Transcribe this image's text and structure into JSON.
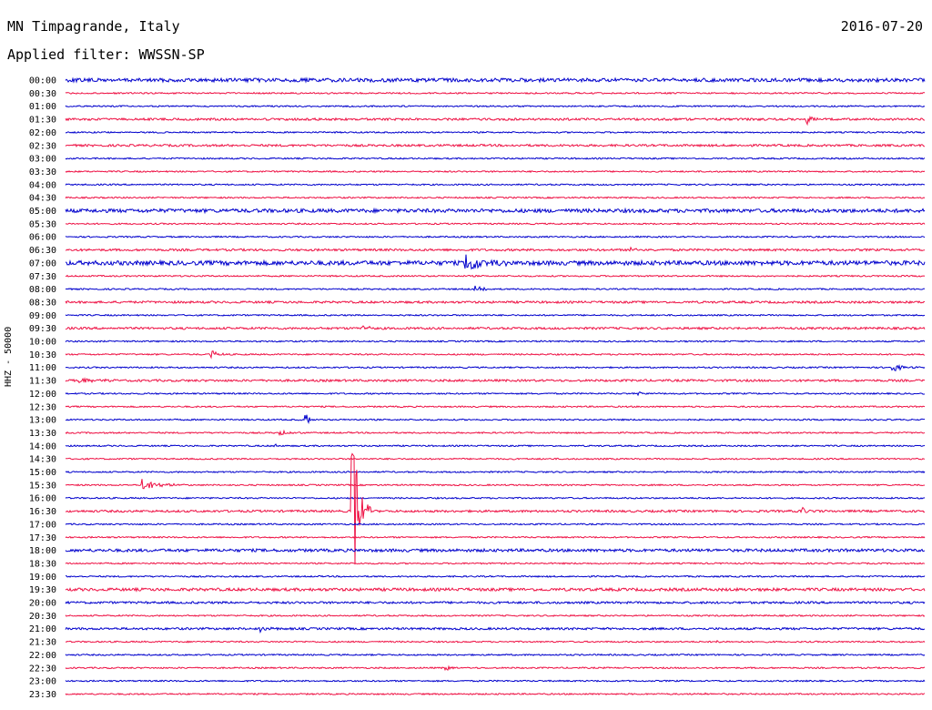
{
  "header": {
    "station": "MN Timpagrande, Italy",
    "filter": "Applied filter: WWSSN-SP",
    "date": "2016-07-20"
  },
  "chart_data": {
    "type": "line",
    "title": "MN Timpagrande, Italy",
    "subtitle": "Applied filter: WWSSN-SP",
    "ylabel": "HHZ - 50000",
    "rows": [
      "00:00",
      "00:30",
      "01:00",
      "01:30",
      "02:00",
      "02:30",
      "03:00",
      "03:30",
      "04:00",
      "04:30",
      "05:00",
      "05:30",
      "06:00",
      "06:30",
      "07:00",
      "07:30",
      "08:00",
      "08:30",
      "09:00",
      "09:30",
      "10:00",
      "10:30",
      "11:00",
      "11:30",
      "12:00",
      "12:30",
      "13:00",
      "13:30",
      "14:00",
      "14:30",
      "15:00",
      "15:30",
      "16:00",
      "16:30",
      "17:00",
      "17:30",
      "18:00",
      "18:30",
      "19:00",
      "19:30",
      "20:00",
      "20:30",
      "21:00",
      "21:30",
      "22:00",
      "22:30",
      "23:00",
      "23:30"
    ],
    "colors": [
      "#0000cc",
      "#ee1144"
    ],
    "noise": [
      2.5,
      1.0,
      1.0,
      1.5,
      1.0,
      1.5,
      1.0,
      1.0,
      1.0,
      1.0,
      2.5,
      1.0,
      1.0,
      1.5,
      3.0,
      1.0,
      1.0,
      1.5,
      1.0,
      1.5,
      1.0,
      1.0,
      1.0,
      1.5,
      1.0,
      1.0,
      1.0,
      1.0,
      1.0,
      1.0,
      1.0,
      1.0,
      1.0,
      1.5,
      1.0,
      1.0,
      2.0,
      1.0,
      1.0,
      2.0,
      1.5,
      1.0,
      1.5,
      1.0,
      1.0,
      1.0,
      1.0,
      1.0
    ],
    "events": [
      {
        "row": 3,
        "minute": 25.9,
        "amplitude": 7,
        "duration": 0.6
      },
      {
        "row": 13,
        "minute": 19.7,
        "amplitude": 4,
        "duration": 0.8
      },
      {
        "row": 14,
        "minute": 14.0,
        "amplitude": 12,
        "duration": 1.5
      },
      {
        "row": 16,
        "minute": 14.3,
        "amplitude": 3,
        "duration": 0.8
      },
      {
        "row": 19,
        "minute": 10.4,
        "amplitude": 3,
        "duration": 0.6
      },
      {
        "row": 21,
        "minute": 5.1,
        "amplitude": 5,
        "duration": 0.6
      },
      {
        "row": 22,
        "minute": 28.9,
        "amplitude": 4,
        "duration": 1.0
      },
      {
        "row": 23,
        "minute": 0.5,
        "amplitude": 3,
        "duration": 1.5
      },
      {
        "row": 24,
        "minute": 20.0,
        "amplitude": 3,
        "duration": 0.5
      },
      {
        "row": 26,
        "minute": 8.4,
        "amplitude": 8,
        "duration": 0.3
      },
      {
        "row": 27,
        "minute": 7.5,
        "amplitude": 3,
        "duration": 1.0
      },
      {
        "row": 28,
        "minute": 7.3,
        "amplitude": 3,
        "duration": 0.3
      },
      {
        "row": 31,
        "minute": 2.7,
        "amplitude": 7,
        "duration": 1.5
      },
      {
        "row": 33,
        "minute": 10.0,
        "amplitude": 95,
        "duration": 0.7
      },
      {
        "row": 33,
        "minute": 25.7,
        "amplitude": 5,
        "duration": 0.6
      },
      {
        "row": 42,
        "minute": 6.8,
        "amplitude": 3,
        "duration": 0.8
      },
      {
        "row": 43,
        "minute": 22.6,
        "amplitude": 3,
        "duration": 0.6
      },
      {
        "row": 45,
        "minute": 13.3,
        "amplitude": 3,
        "duration": 0.6
      },
      {
        "row": 47,
        "minute": 22.3,
        "amplitude": 4,
        "duration": 0.2
      }
    ]
  }
}
